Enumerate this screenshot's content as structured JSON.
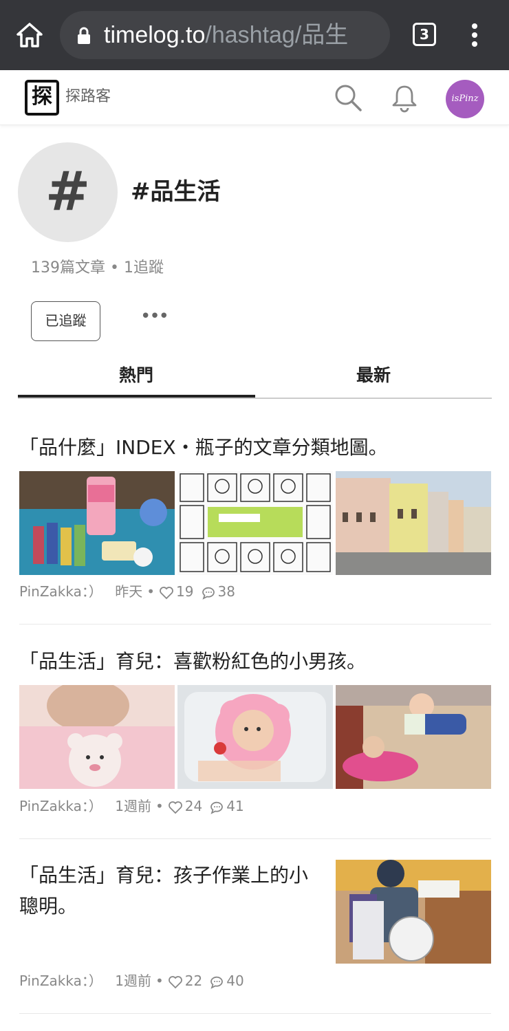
{
  "browser": {
    "url_host": "timelog.to",
    "url_path": "/hashtag/品生",
    "tab_count": "3"
  },
  "site": {
    "logo_char": "探",
    "logo_text": "探路客",
    "avatar_text": "isPinz"
  },
  "hashtag": {
    "symbol": "#",
    "title": "#品生活",
    "stats": "139篇文章 • 1追蹤",
    "follow_label": "已追蹤",
    "more_label": "•••"
  },
  "tabs": [
    {
      "label": "熱門",
      "active": true
    },
    {
      "label": "最新",
      "active": false
    }
  ],
  "articles": [
    {
      "title": "「品什麼」INDEX・瓶子的文章分類地圖。",
      "author": "PinZakka：）",
      "time": "昨天",
      "likes": "19",
      "comments": "38"
    },
    {
      "title": "「品生活」育兒：喜歡粉紅色的小男孩。",
      "author": "PinZakka：）",
      "time": "1週前",
      "likes": "24",
      "comments": "41"
    },
    {
      "title": "「品生活」育兒：孩子作業上的小聰明。",
      "author": "PinZakka：）",
      "time": "1週前",
      "likes": "22",
      "comments": "40"
    }
  ],
  "colors": {
    "chrome_bg": "#35363a",
    "urlbar_bg": "#424347",
    "avatar_bg": "#a55cbf",
    "tag_avatar_bg": "#e6e6e6",
    "meta_text": "#888888"
  }
}
